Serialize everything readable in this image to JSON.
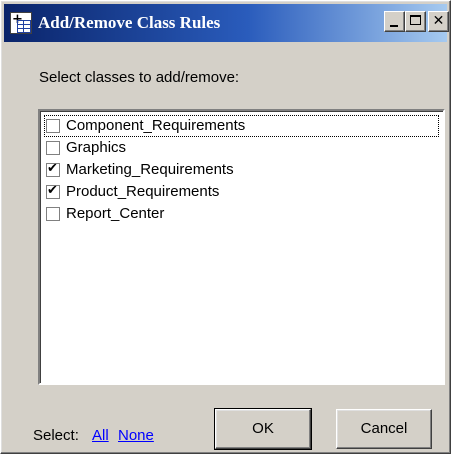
{
  "window": {
    "title": "Add/Remove Class Rules",
    "icons": {
      "app": "add-table-icon",
      "minimize": "minimize-icon",
      "maximize": "maximize-icon",
      "close": "close-icon"
    }
  },
  "prompt": "Select classes to add/remove:",
  "classes": [
    {
      "label": "Component_Requirements",
      "checked": false
    },
    {
      "label": "Graphics",
      "checked": false
    },
    {
      "label": "Marketing_Requirements",
      "checked": true
    },
    {
      "label": "Product_Requirements",
      "checked": true
    },
    {
      "label": "Report_Center",
      "checked": false
    }
  ],
  "footer": {
    "select_label": "Select:",
    "all_link": "All",
    "none_link": "None",
    "ok_button": "OK",
    "cancel_button": "Cancel"
  },
  "colors": {
    "titlebar_start": "#0a246a",
    "titlebar_end": "#a6caf0",
    "face": "#d4d0c8",
    "link": "#0000ff"
  }
}
